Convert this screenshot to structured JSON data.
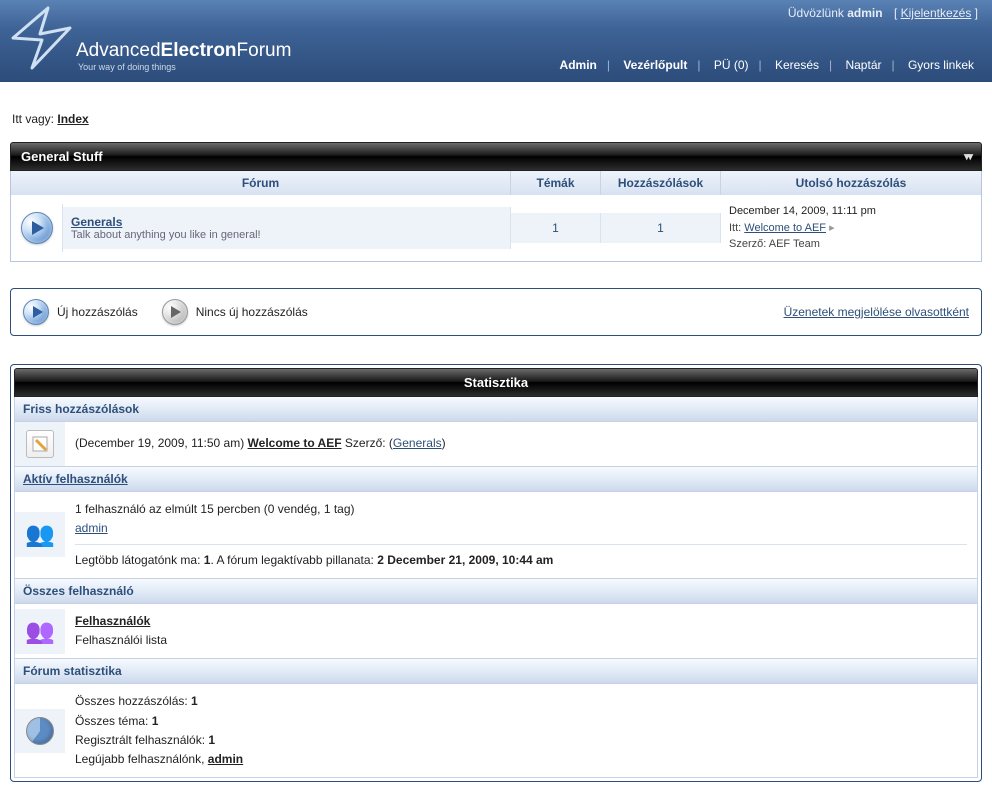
{
  "header": {
    "brand_pre": "Advanced",
    "brand_mid": "Electron",
    "brand_post": "Forum",
    "tagline": "Your way of doing things",
    "welcome_prefix": "Üdvözlünk ",
    "welcome_user": "admin",
    "logout": "Kijelentkezés"
  },
  "nav": {
    "admin": "Admin",
    "cp": "Vezérlőpult",
    "pm": "PÜ (0)",
    "search": "Keresés",
    "calendar": "Naptár",
    "quicklinks": "Gyors linkek"
  },
  "breadcrumb": {
    "prefix": "Itt vagy: ",
    "index": "Index"
  },
  "category": {
    "title": "General Stuff",
    "cols": {
      "forum": "Fórum",
      "topics": "Témák",
      "posts": "Hozzászólások",
      "last": "Utolsó hozzászólás"
    },
    "row": {
      "name": "Generals",
      "desc": "Talk about anything you like in general!",
      "topics": "1",
      "posts": "1",
      "last_time": "December 14, 2009, 11:11 pm",
      "last_in_label": "Itt: ",
      "last_topic": "Welcome to AEF",
      "last_by_label": "Szerző: ",
      "last_by": "AEF Team"
    }
  },
  "legend": {
    "new": "Új hozzászólás",
    "nonew": "Nincs új hozzászólás",
    "mark_read": "Üzenetek megjelölése olvasottként"
  },
  "stats": {
    "title": "Statisztika",
    "s1": {
      "heading": "Friss hozzászólások",
      "time": "(December 19, 2009, 11:50 am) ",
      "topic": "Welcome to AEF",
      "by_label": " Szerző: (",
      "by": "Generals",
      "close": ")"
    },
    "s2": {
      "heading": "Aktív felhasználók",
      "line1": "1 felhasználó az elmúlt 15 percben (0 vendég, 1 tag)",
      "user": "admin",
      "line2a": "Legtöbb látogatónk ma: ",
      "line2a_val": "1",
      "line2b": ". A fórum legaktívabb pillanata: ",
      "line2b_val": "2 December 21, 2009, 10:44 am"
    },
    "s3": {
      "heading": "Összes felhasználó",
      "link": "Felhasználók",
      "desc": "Felhasználói lista"
    },
    "s4": {
      "heading": "Fórum statisztika",
      "l1": "Összes hozzászólás: ",
      "v1": "1",
      "l2": "Összes téma: ",
      "v2": "1",
      "l3": "Regisztrált felhasználók: ",
      "v3": "1",
      "l4": "Legújabb felhasználónk, ",
      "user": "admin"
    }
  }
}
